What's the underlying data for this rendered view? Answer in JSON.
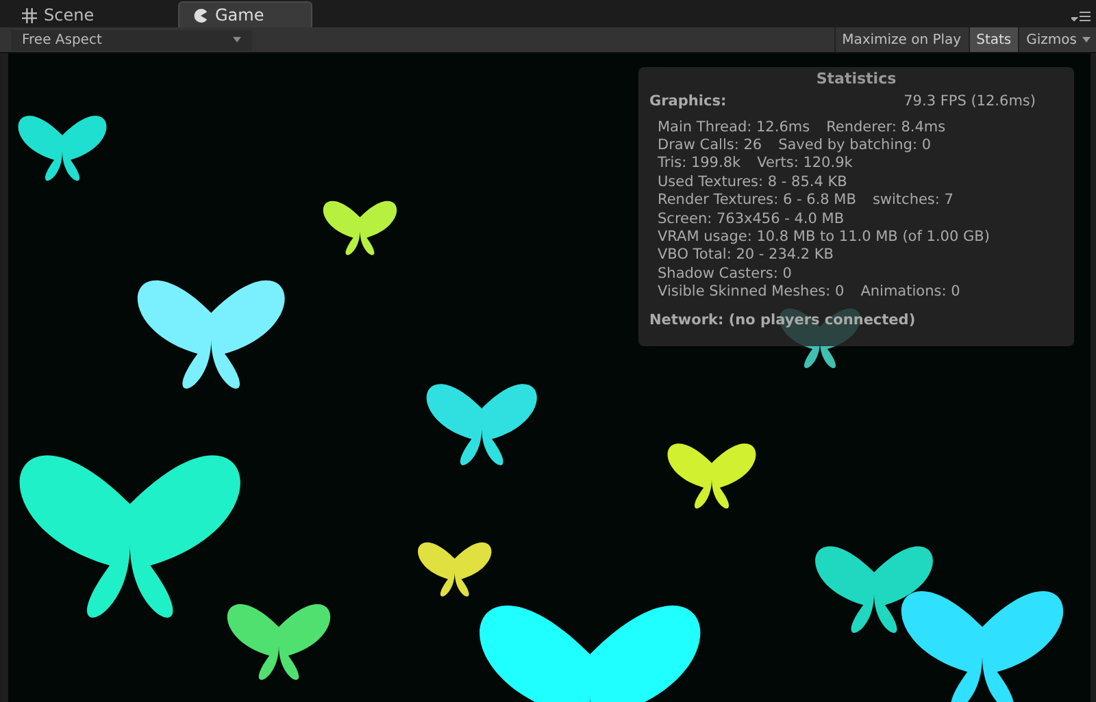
{
  "tabs": [
    {
      "label": "Scene",
      "kind": "scene",
      "selected": false
    },
    {
      "label": "Game",
      "kind": "game",
      "selected": true
    }
  ],
  "toolbar": {
    "aspect": "Free Aspect",
    "toggles": [
      {
        "label": "Maximize on Play",
        "on": false
      },
      {
        "label": "Stats",
        "on": true
      }
    ],
    "gizmos": "Gizmos"
  },
  "statistics": {
    "title": "Statistics",
    "graphics_label": "Graphics:",
    "fps": "79.3 FPS (12.6ms)",
    "rows": [
      [
        "Main Thread: 12.6ms",
        "Renderer: 8.4ms"
      ],
      [
        "Draw Calls: 26",
        "Saved by batching: 0"
      ],
      [
        "Tris: 199.8k",
        "Verts: 120.9k"
      ],
      [
        "Used Textures: 8 - 85.4 KB"
      ],
      [
        "Render Textures: 6 - 6.8 MB",
        "switches: 7"
      ],
      [
        "Screen: 763x456 - 4.0 MB"
      ],
      [
        "VRAM usage: 10.8 MB to 11.0 MB (of 1.00 GB)"
      ],
      [
        "VBO Total: 20 - 234.2 KB"
      ],
      [
        "Shadow Casters: 0"
      ],
      [
        "Visible Skinned Meshes: 0",
        "Animations: 0"
      ]
    ],
    "network": "Network: (no players connected)"
  }
}
